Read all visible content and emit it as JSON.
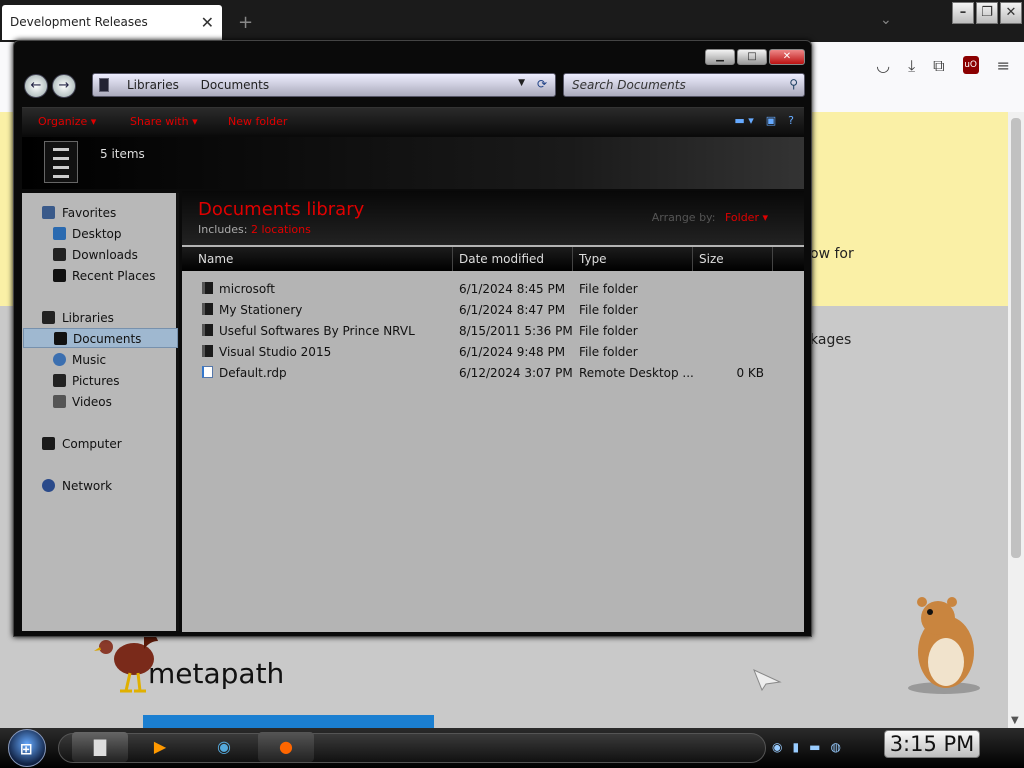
{
  "browser": {
    "tab_title": "Development Releases",
    "tab_close": "✕",
    "new_tab": "+",
    "tab_list": "⌄"
  },
  "page": {
    "snippet1": "ow for",
    "snippet2": "kages",
    "metapath": "metapath"
  },
  "explorer": {
    "address": {
      "segment1": "Libraries",
      "segment2": "Documents"
    },
    "search_placeholder": "Search Documents",
    "toolbar": {
      "organize": "Organize",
      "share_with": "Share with",
      "new_folder": "New folder"
    },
    "item_count": "5 items",
    "nav": {
      "favorites": "Favorites",
      "desktop": "Desktop",
      "downloads": "Downloads",
      "recent": "Recent Places",
      "libraries": "Libraries",
      "documents": "Documents",
      "music": "Music",
      "pictures": "Pictures",
      "videos": "Videos",
      "computer": "Computer",
      "network": "Network"
    },
    "library": {
      "title": "Documents library",
      "includes_label": "Includes:",
      "locations": "2 locations",
      "arrange_label": "Arrange by:",
      "arrange_value": "Folder"
    },
    "columns": {
      "name": "Name",
      "date": "Date modified",
      "type": "Type",
      "size": "Size"
    },
    "files": [
      {
        "name": "microsoft",
        "date": "6/1/2024 8:45 PM",
        "type": "File folder",
        "size": ""
      },
      {
        "name": "My Stationery",
        "date": "6/1/2024 8:47 PM",
        "type": "File folder",
        "size": ""
      },
      {
        "name": "Useful Softwares By Prince NRVL",
        "date": "8/15/2011 5:36 PM",
        "type": "File folder",
        "size": ""
      },
      {
        "name": "Visual Studio 2015",
        "date": "6/1/2024 9:48 PM",
        "type": "File folder",
        "size": ""
      },
      {
        "name": "Default.rdp",
        "date": "6/12/2024 3:07 PM",
        "type": "Remote Desktop ...",
        "size": "0 KB"
      }
    ]
  },
  "taskbar": {
    "clock": "3:15 PM"
  },
  "colors": {
    "accent_red": "#e00000",
    "selection": "#9fb8d0"
  }
}
